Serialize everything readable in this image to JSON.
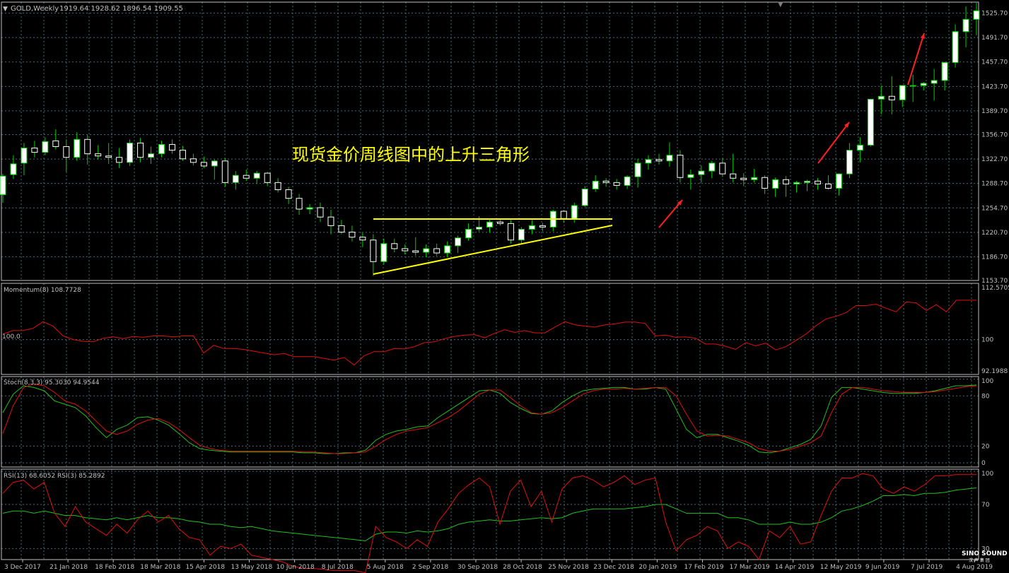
{
  "title_bar": {
    "symbol": "GOLD,Weekly",
    "ohlc": "1919.64 1928.62 1896.54 1909.55"
  },
  "annotation": {
    "headline": "现货金价周线图中的上升三角形"
  },
  "watermark": {
    "brand": "SINO SOUND",
    "brand_cn": "汉 声 集 团"
  },
  "colors": {
    "background": "#000000",
    "grid": "#4a6a78",
    "frame": "#c0c0c0",
    "bull_body": "#ffffff",
    "wick": "#00d000",
    "triangle": "#ffff00",
    "arrows": "#ff2020",
    "indicator_red": "#e01010",
    "indicator_green": "#20c020",
    "text": "#c0c0c0"
  },
  "chart_data": [
    {
      "type": "candlestick",
      "name": "price",
      "y_ticks": [
        "1525.70",
        "1491.70",
        "1457.70",
        "1423.70",
        "1389.70",
        "1356.70",
        "1322.70",
        "1288.70",
        "1254.70",
        "1220.70",
        "1186.70",
        "1153.70"
      ],
      "ylim": [
        1153.7,
        1541
      ],
      "x_labels": [
        "3 Dec 2017",
        "21 Jan 2018",
        "18 Feb 2018",
        "18 Mar 2018",
        "15 Apr 2018",
        "13 May 2018",
        "10 Jun 2018",
        "8 Jul 2018",
        "5 Aug 2018",
        "2 Sep 2018",
        "30 Sep 2018",
        "28 Oct 2018",
        "25 Nov 2018",
        "23 Dec 2018",
        "20 Jan 2019",
        "17 Feb 2019",
        "17 Mar 2019",
        "14 Apr 2019",
        "12 May 2019",
        "9 Jun 2019",
        "7 Jul 2019",
        "4 Aug 2019"
      ],
      "ohlc": [
        [
          1273,
          1302,
          1262,
          1299
        ],
        [
          1301,
          1328,
          1295,
          1316
        ],
        [
          1317,
          1345,
          1300,
          1338
        ],
        [
          1338,
          1348,
          1325,
          1332
        ],
        [
          1332,
          1353,
          1328,
          1347
        ],
        [
          1348,
          1364,
          1336,
          1340
        ],
        [
          1340,
          1350,
          1305,
          1325
        ],
        [
          1325,
          1360,
          1320,
          1350
        ],
        [
          1350,
          1356,
          1315,
          1330
        ],
        [
          1330,
          1342,
          1322,
          1327
        ],
        [
          1327,
          1345,
          1316,
          1325
        ],
        [
          1325,
          1338,
          1310,
          1318
        ],
        [
          1318,
          1350,
          1313,
          1345
        ],
        [
          1345,
          1352,
          1318,
          1325
        ],
        [
          1325,
          1340,
          1316,
          1330
        ],
        [
          1330,
          1348,
          1325,
          1343
        ],
        [
          1343,
          1350,
          1330,
          1335
        ],
        [
          1335,
          1341,
          1320,
          1323
        ],
        [
          1323,
          1330,
          1314,
          1318
        ],
        [
          1318,
          1326,
          1310,
          1313
        ],
        [
          1313,
          1322,
          1294,
          1320
        ],
        [
          1320,
          1324,
          1284,
          1290
        ],
        [
          1290,
          1306,
          1280,
          1300
        ],
        [
          1300,
          1308,
          1292,
          1296
        ],
        [
          1296,
          1306,
          1288,
          1303
        ],
        [
          1303,
          1305,
          1285,
          1290
        ],
        [
          1290,
          1296,
          1276,
          1280
        ],
        [
          1280,
          1284,
          1260,
          1268
        ],
        [
          1268,
          1274,
          1245,
          1253
        ],
        [
          1253,
          1260,
          1246,
          1255
        ],
        [
          1255,
          1262,
          1235,
          1242
        ],
        [
          1242,
          1252,
          1218,
          1230
        ],
        [
          1230,
          1238,
          1218,
          1221
        ],
        [
          1221,
          1230,
          1208,
          1214
        ],
        [
          1214,
          1220,
          1200,
          1210
        ],
        [
          1210,
          1218,
          1160,
          1180
        ],
        [
          1180,
          1212,
          1176,
          1205
        ],
        [
          1205,
          1212,
          1193,
          1198
        ],
        [
          1198,
          1204,
          1190,
          1195
        ],
        [
          1195,
          1214,
          1188,
          1193
        ],
        [
          1193,
          1204,
          1186,
          1198
        ],
        [
          1198,
          1205,
          1188,
          1192
        ],
        [
          1192,
          1208,
          1186,
          1202
        ],
        [
          1202,
          1216,
          1192,
          1213
        ],
        [
          1213,
          1233,
          1209,
          1225
        ],
        [
          1225,
          1243,
          1222,
          1228
        ],
        [
          1228,
          1238,
          1220,
          1235
        ],
        [
          1235,
          1240,
          1230,
          1233
        ],
        [
          1233,
          1238,
          1205,
          1210
        ],
        [
          1210,
          1228,
          1204,
          1225
        ],
        [
          1225,
          1238,
          1218,
          1230
        ],
        [
          1230,
          1234,
          1222,
          1228
        ],
        [
          1228,
          1252,
          1222,
          1250
        ],
        [
          1250,
          1252,
          1234,
          1240
        ],
        [
          1240,
          1262,
          1234,
          1258
        ],
        [
          1258,
          1285,
          1256,
          1281
        ],
        [
          1281,
          1300,
          1277,
          1292
        ],
        [
          1292,
          1296,
          1284,
          1290
        ],
        [
          1290,
          1295,
          1280,
          1286
        ],
        [
          1286,
          1300,
          1281,
          1298
        ],
        [
          1298,
          1323,
          1283,
          1317
        ],
        [
          1317,
          1328,
          1308,
          1322
        ],
        [
          1322,
          1330,
          1315,
          1320
        ],
        [
          1320,
          1346,
          1312,
          1328
        ],
        [
          1328,
          1335,
          1290,
          1297
        ],
        [
          1297,
          1308,
          1280,
          1301
        ],
        [
          1301,
          1314,
          1290,
          1306
        ],
        [
          1306,
          1320,
          1296,
          1317
        ],
        [
          1317,
          1324,
          1298,
          1302
        ],
        [
          1302,
          1330,
          1290,
          1296
        ],
        [
          1296,
          1303,
          1285,
          1294
        ],
        [
          1294,
          1309,
          1290,
          1297
        ],
        [
          1297,
          1300,
          1274,
          1282
        ],
        [
          1282,
          1297,
          1270,
          1294
        ],
        [
          1294,
          1299,
          1270,
          1288
        ],
        [
          1288,
          1292,
          1276,
          1290
        ],
        [
          1290,
          1294,
          1278,
          1292
        ],
        [
          1292,
          1296,
          1280,
          1288
        ],
        [
          1288,
          1300,
          1280,
          1282
        ],
        [
          1282,
          1303,
          1272,
          1302
        ],
        [
          1302,
          1345,
          1296,
          1335
        ],
        [
          1335,
          1353,
          1318,
          1342
        ],
        [
          1342,
          1395,
          1340,
          1406
        ],
        [
          1406,
          1425,
          1385,
          1410
        ],
        [
          1410,
          1438,
          1385,
          1405
        ],
        [
          1405,
          1422,
          1395,
          1425
        ],
        [
          1425,
          1440,
          1402,
          1425
        ],
        [
          1425,
          1430,
          1418,
          1428
        ],
        [
          1428,
          1448,
          1404,
          1432
        ],
        [
          1432,
          1458,
          1418,
          1457
        ],
        [
          1457,
          1510,
          1450,
          1500
        ],
        [
          1500,
          1535,
          1478,
          1517
        ],
        [
          1517,
          1540,
          1495,
          1529
        ]
      ],
      "headline_pos": "upper-center"
    },
    {
      "type": "line",
      "name": "Momentum(8)",
      "label": "Momentum(8) 108.7728",
      "y_ticks": [
        "112.5705",
        "100",
        "92.1988"
      ],
      "left_tick": "100.0",
      "series": [
        {
          "name": "Momentum(8)",
          "color": "#e01010",
          "values": [
            101.2,
            102.0,
            102.0,
            102.5,
            104.0,
            103.0,
            100.8,
            100.0,
            99.6,
            99.5,
            100.3,
            100.6,
            100.2,
            100.7,
            100.5,
            100.8,
            100.8,
            100.6,
            100.8,
            100.8,
            97.0,
            98.7,
            98.0,
            98.0,
            97.8,
            97.4,
            97.0,
            96.6,
            96.9,
            96.2,
            96.2,
            96.2,
            95.8,
            95.4,
            96.0,
            94.3,
            96.4,
            97.3,
            97.3,
            98.0,
            97.9,
            98.4,
            99.3,
            99.5,
            100.2,
            100.7,
            101.0,
            101.1,
            100.4,
            101.4,
            102.2,
            101.6,
            102.0,
            101.5,
            101.5,
            102.8,
            104.0,
            103.3,
            103.0,
            102.8,
            103.3,
            103.5,
            103.9,
            103.9,
            103.6,
            100.8,
            101.0,
            100.5,
            100.6,
            100.3,
            99.0,
            99.0,
            98.5,
            97.8,
            99.3,
            98.6,
            99.2,
            97.7,
            98.4,
            99.8,
            101.2,
            103.1,
            104.6,
            105.2,
            106.0,
            107.6,
            107.6,
            107.9,
            107.0,
            106.2,
            108.4,
            108.2,
            106.5,
            107.8,
            106.2,
            108.8,
            108.8,
            108.8
          ]
        }
      ],
      "ylim": [
        92.1988,
        112.5705
      ]
    },
    {
      "type": "line",
      "name": "Stoch(8,3,3)",
      "label": "Stoch(8,3,3) 95.3030 94.9544",
      "y_ticks": [
        "100",
        "80",
        "20",
        "0"
      ],
      "ylim": [
        0,
        100
      ],
      "series": [
        {
          "name": "main",
          "color": "#20c020",
          "values": [
            60,
            82,
            92,
            90,
            86,
            74,
            70,
            66,
            56,
            42,
            30,
            40,
            45,
            54,
            55,
            51,
            45,
            35,
            24,
            17,
            15,
            14,
            13,
            13,
            13,
            13,
            13,
            13,
            13,
            12,
            12,
            11,
            11,
            12,
            12,
            15,
            27,
            34,
            38,
            40,
            43,
            44,
            54,
            62,
            70,
            78,
            86,
            87,
            83,
            72,
            65,
            59,
            58,
            62,
            72,
            80,
            86,
            88,
            89,
            90,
            90,
            88,
            88,
            90,
            88,
            64,
            40,
            30,
            34,
            34,
            30,
            26,
            21,
            13,
            12,
            14,
            18,
            22,
            28,
            44,
            78,
            90,
            90,
            88,
            86,
            84,
            83,
            83,
            83,
            84,
            86,
            89,
            92,
            92,
            93
          ]
        },
        {
          "name": "signal",
          "color": "#e01010",
          "values": [
            35,
            68,
            90,
            94,
            92,
            84,
            74,
            70,
            62,
            50,
            38,
            34,
            38,
            46,
            51,
            53,
            48,
            40,
            30,
            21,
            17,
            15,
            14,
            14,
            14,
            14,
            14,
            14,
            14,
            13,
            13,
            12,
            11,
            11,
            12,
            13,
            20,
            28,
            34,
            38,
            40,
            42,
            48,
            54,
            62,
            72,
            82,
            87,
            87,
            78,
            68,
            60,
            58,
            60,
            66,
            74,
            82,
            86,
            88,
            88,
            89,
            88,
            89,
            90,
            90,
            80,
            58,
            38,
            32,
            33,
            32,
            28,
            24,
            17,
            14,
            14,
            16,
            20,
            24,
            32,
            60,
            82,
            90,
            90,
            88,
            86,
            85,
            84,
            84,
            84,
            85,
            87,
            89,
            91,
            92
          ]
        }
      ]
    },
    {
      "type": "line",
      "name": "RSI",
      "label": "RSI(13) 68.6052  RSI(3) 85.2892",
      "y_ticks": [
        "100",
        "70",
        "30"
      ],
      "ylim": [
        20,
        102
      ],
      "series": [
        {
          "name": "RSI(13)",
          "color": "#20c020",
          "values": [
            62,
            64,
            64,
            62,
            64,
            62,
            60,
            60,
            58,
            57,
            56,
            58,
            56,
            58,
            60,
            58,
            58,
            57,
            55,
            54,
            52,
            52,
            50,
            49,
            50,
            48,
            46,
            45,
            44,
            43,
            42,
            41,
            40,
            39,
            38,
            37,
            43,
            45,
            45,
            44,
            46,
            45,
            46,
            48,
            52,
            54,
            55,
            56,
            55,
            55,
            56,
            57,
            58,
            57,
            58,
            62,
            64,
            66,
            66,
            66,
            66,
            67,
            68,
            70,
            70,
            66,
            62,
            62,
            62,
            62,
            58,
            58,
            56,
            52,
            52,
            52,
            54,
            52,
            52,
            54,
            58,
            64,
            66,
            69,
            73,
            78,
            78,
            79,
            78,
            80,
            80,
            81,
            83,
            84,
            85
          ]
        },
        {
          "name": "RSI(3)",
          "color": "#e01010",
          "values": [
            80,
            90,
            92,
            84,
            90,
            62,
            50,
            68,
            54,
            48,
            42,
            52,
            44,
            56,
            64,
            54,
            60,
            48,
            40,
            38,
            24,
            32,
            30,
            34,
            24,
            22,
            20,
            18,
            14,
            12,
            12,
            11,
            10,
            10,
            10,
            8,
            50,
            40,
            36,
            30,
            38,
            32,
            54,
            66,
            80,
            88,
            94,
            86,
            52,
            82,
            92,
            68,
            82,
            54,
            84,
            94,
            96,
            92,
            86,
            90,
            96,
            88,
            92,
            94,
            54,
            28,
            38,
            42,
            50,
            46,
            30,
            36,
            32,
            20,
            46,
            40,
            50,
            34,
            36,
            60,
            82,
            94,
            94,
            98,
            96,
            84,
            80,
            86,
            82,
            88,
            96,
            96,
            97,
            97,
            97
          ]
        }
      ]
    }
  ]
}
